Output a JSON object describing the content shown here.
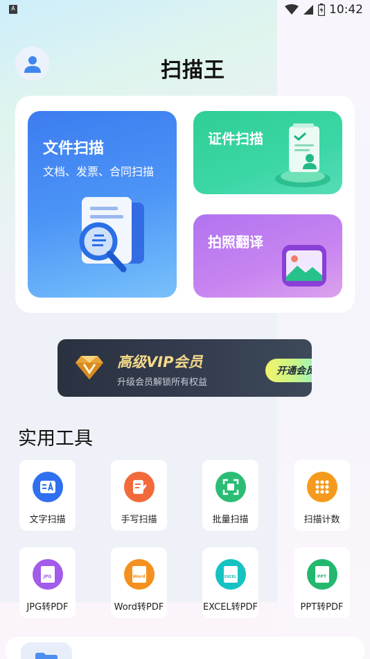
{
  "status_bar": {
    "indicator": "A",
    "time": "10:42"
  },
  "header": {
    "title": "扫描王",
    "avatar_icon": "user-icon"
  },
  "main_tiles": {
    "doc_scan": {
      "title": "文件扫描",
      "subtitle": "文档、发票、合同扫描"
    },
    "id_scan": {
      "title": "证件扫描"
    },
    "photo_translate": {
      "title": "拍照翻译"
    }
  },
  "vip_banner": {
    "title": "高级VIP会员",
    "subtitle": "升级会员解锁所有权益",
    "button_label": "开通会员"
  },
  "tools": {
    "section_title": "实用工具",
    "items": [
      {
        "label": "文字扫描",
        "color": "#2f6ff0"
      },
      {
        "label": "手写扫描",
        "color": "#f26a3b"
      },
      {
        "label": "批量扫描",
        "color": "#2bbd75"
      },
      {
        "label": "扫描计数",
        "color": "#f59a1d"
      },
      {
        "label": "JPG转PDF",
        "color": "#a25bea",
        "badge": "JPG"
      },
      {
        "label": "Word转PDF",
        "color": "#f4901f",
        "badge": "Word"
      },
      {
        "label": "EXCEL转PDF",
        "color": "#16c2c2",
        "badge": "EXCEL"
      },
      {
        "label": "PPT转PDF",
        "color": "#22b86e",
        "badge": "PPT"
      }
    ]
  },
  "colors": {
    "brand_blue": "#3c7cf0",
    "brand_green": "#2fcf94",
    "brand_purple": "#b173f0",
    "vip_gold": "#f5d98a"
  }
}
